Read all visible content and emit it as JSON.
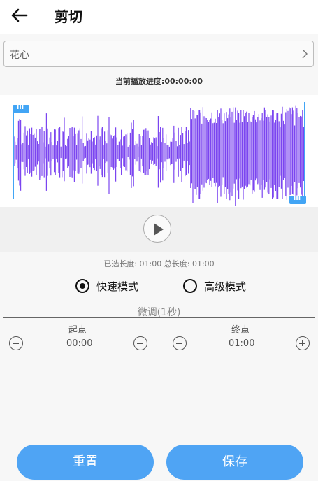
{
  "header": {
    "title": "剪切",
    "back_icon": "arrow-left-icon"
  },
  "song_select": {
    "value": "花心",
    "icon": "chevron-right-icon"
  },
  "progress": {
    "label": "当前播放进度:00:00:00"
  },
  "waveform": {
    "color": "#7b45f0",
    "handle_color": "#42a5f5",
    "start_handle_label": "III",
    "end_handle_label": "III"
  },
  "player": {
    "play_icon": "play-icon"
  },
  "length_info": {
    "text": "已选长度: 01:00 总长度: 01:00"
  },
  "modes": [
    {
      "label": "快速模式",
      "selected": true
    },
    {
      "label": "高级模式",
      "selected": false
    }
  ],
  "fine_tune": {
    "title": "微调(1秒)",
    "start": {
      "label": "起点",
      "value": "00:00"
    },
    "end": {
      "label": "终点",
      "value": "01:00"
    }
  },
  "buttons": {
    "reset": "重置",
    "save": "保存"
  },
  "colors": {
    "accent": "#4fa4f4",
    "waveform": "#7b45f0"
  }
}
